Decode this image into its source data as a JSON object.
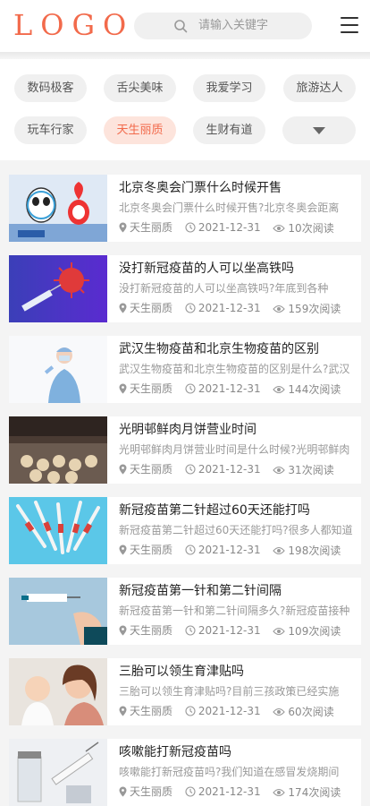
{
  "header": {
    "logo": "LOGO",
    "search_placeholder": "请输入关键字"
  },
  "categories": [
    {
      "label": "数码极客",
      "active": false
    },
    {
      "label": "舌尖美味",
      "active": false
    },
    {
      "label": "我爱学习",
      "active": false
    },
    {
      "label": "旅游达人",
      "active": false
    },
    {
      "label": "玩车行家",
      "active": false
    },
    {
      "label": "天生丽质",
      "active": true
    },
    {
      "label": "生财有道",
      "active": false
    }
  ],
  "articles": [
    {
      "title": "北京冬奥会门票什么时候开售",
      "desc": "北京冬奥会门票什么时候开售?北京冬奥会距离",
      "category": "天生丽质",
      "date": "2021-12-31",
      "views": "10次阅读",
      "thumb": "winter-olympic-mascots"
    },
    {
      "title": "没打新冠疫苗的人可以坐高铁吗",
      "desc": "没打新冠疫苗的人可以坐高铁吗?年底到各种",
      "category": "天生丽质",
      "date": "2021-12-31",
      "views": "159次阅读",
      "thumb": "virus-syringe"
    },
    {
      "title": "武汉生物疫苗和北京生物疫苗的区别",
      "desc": "武汉生物疫苗和北京生物疫苗的区别是什么?武汉",
      "category": "天生丽质",
      "date": "2021-12-31",
      "views": "144次阅读",
      "thumb": "nurse"
    },
    {
      "title": "光明邨鲜肉月饼营业时间",
      "desc": "光明邨鲜肉月饼营业时间是什么时候?光明邨鲜肉",
      "category": "天生丽质",
      "date": "2021-12-31",
      "views": "31次阅读",
      "thumb": "mooncakes"
    },
    {
      "title": "新冠疫苗第二针超过60天还能打吗",
      "desc": "新冠疫苗第二针超过60天还能打吗?很多人都知道",
      "category": "天生丽质",
      "date": "2021-12-31",
      "views": "198次阅读",
      "thumb": "vaccine-syringes"
    },
    {
      "title": "新冠疫苗第一针和第二针间隔",
      "desc": "新冠疫苗第一针和第二针间隔多久?新冠疫苗接种",
      "category": "天生丽质",
      "date": "2021-12-31",
      "views": "109次阅读",
      "thumb": "injection-hand"
    },
    {
      "title": "三胎可以领生育津贴吗",
      "desc": "三胎可以领生育津贴吗?目前三孩政策已经实施",
      "category": "天生丽质",
      "date": "2021-12-31",
      "views": "60次阅读",
      "thumb": "mother-baby"
    },
    {
      "title": "咳嗽能打新冠疫苗吗",
      "desc": "咳嗽能打新冠疫苗吗?我们知道在感冒发烧期间",
      "category": "天生丽质",
      "date": "2021-12-31",
      "views": "174次阅读",
      "thumb": "syringe-bottles"
    }
  ]
}
